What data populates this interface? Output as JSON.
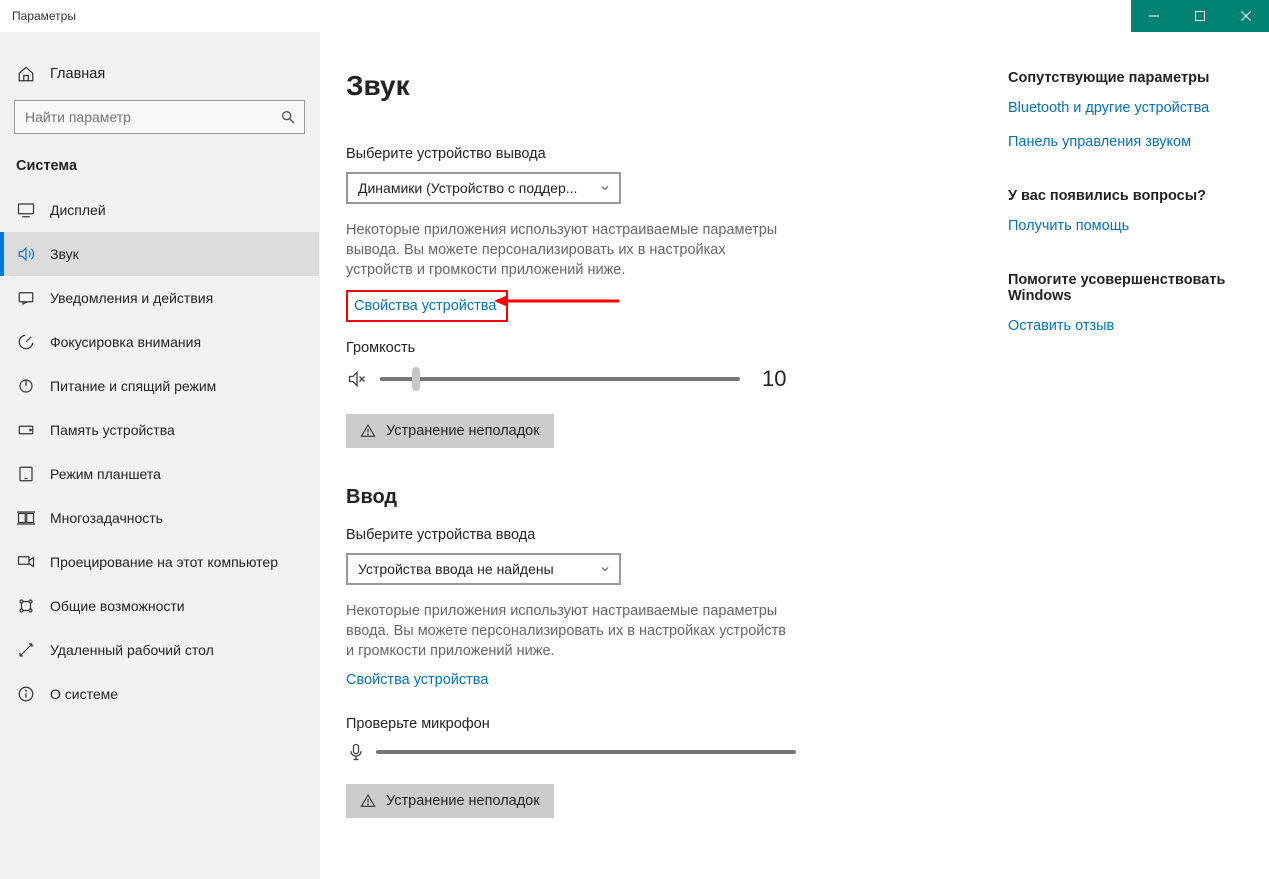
{
  "window": {
    "title": "Параметры"
  },
  "sidebar": {
    "home": "Главная",
    "search_placeholder": "Найти параметр",
    "heading": "Система",
    "items": [
      {
        "label": "Дисплей"
      },
      {
        "label": "Звук"
      },
      {
        "label": "Уведомления и действия"
      },
      {
        "label": "Фокусировка внимания"
      },
      {
        "label": "Питание и спящий режим"
      },
      {
        "label": "Память устройства"
      },
      {
        "label": "Режим планшета"
      },
      {
        "label": "Многозадачность"
      },
      {
        "label": "Проецирование на этот компьютер"
      },
      {
        "label": "Общие возможности"
      },
      {
        "label": "Удаленный рабочий стол"
      },
      {
        "label": "О системе"
      }
    ]
  },
  "main": {
    "page_title": "Звук",
    "output": {
      "label": "Выберите устройство вывода",
      "selected": "Динамики (Устройство с поддер...",
      "desc": "Некоторые приложения используют настраиваемые параметры вывода. Вы можете персонализировать их в настройках устройств и громкости приложений ниже.",
      "properties_link": "Свойства устройства",
      "volume_label": "Громкость",
      "volume_value": "10",
      "troubleshoot": "Устранение неполадок"
    },
    "input": {
      "section_title": "Ввод",
      "label": "Выберите устройства ввода",
      "selected": "Устройства ввода не найдены",
      "desc": "Некоторые приложения используют настраиваемые параметры ввода. Вы можете персонализировать их в настройках устройств и громкости приложений ниже.",
      "properties_link": "Свойства устройства",
      "mic_label": "Проверьте микрофон",
      "troubleshoot": "Устранение неполадок"
    }
  },
  "aside": {
    "related": {
      "title": "Сопутствующие параметры",
      "links": [
        "Bluetooth и другие устройства",
        "Панель управления звуком"
      ]
    },
    "questions": {
      "title": "У вас появились вопросы?",
      "link": "Получить помощь"
    },
    "improve": {
      "title": "Помогите усовершенствовать Windows",
      "link": "Оставить отзыв"
    }
  }
}
